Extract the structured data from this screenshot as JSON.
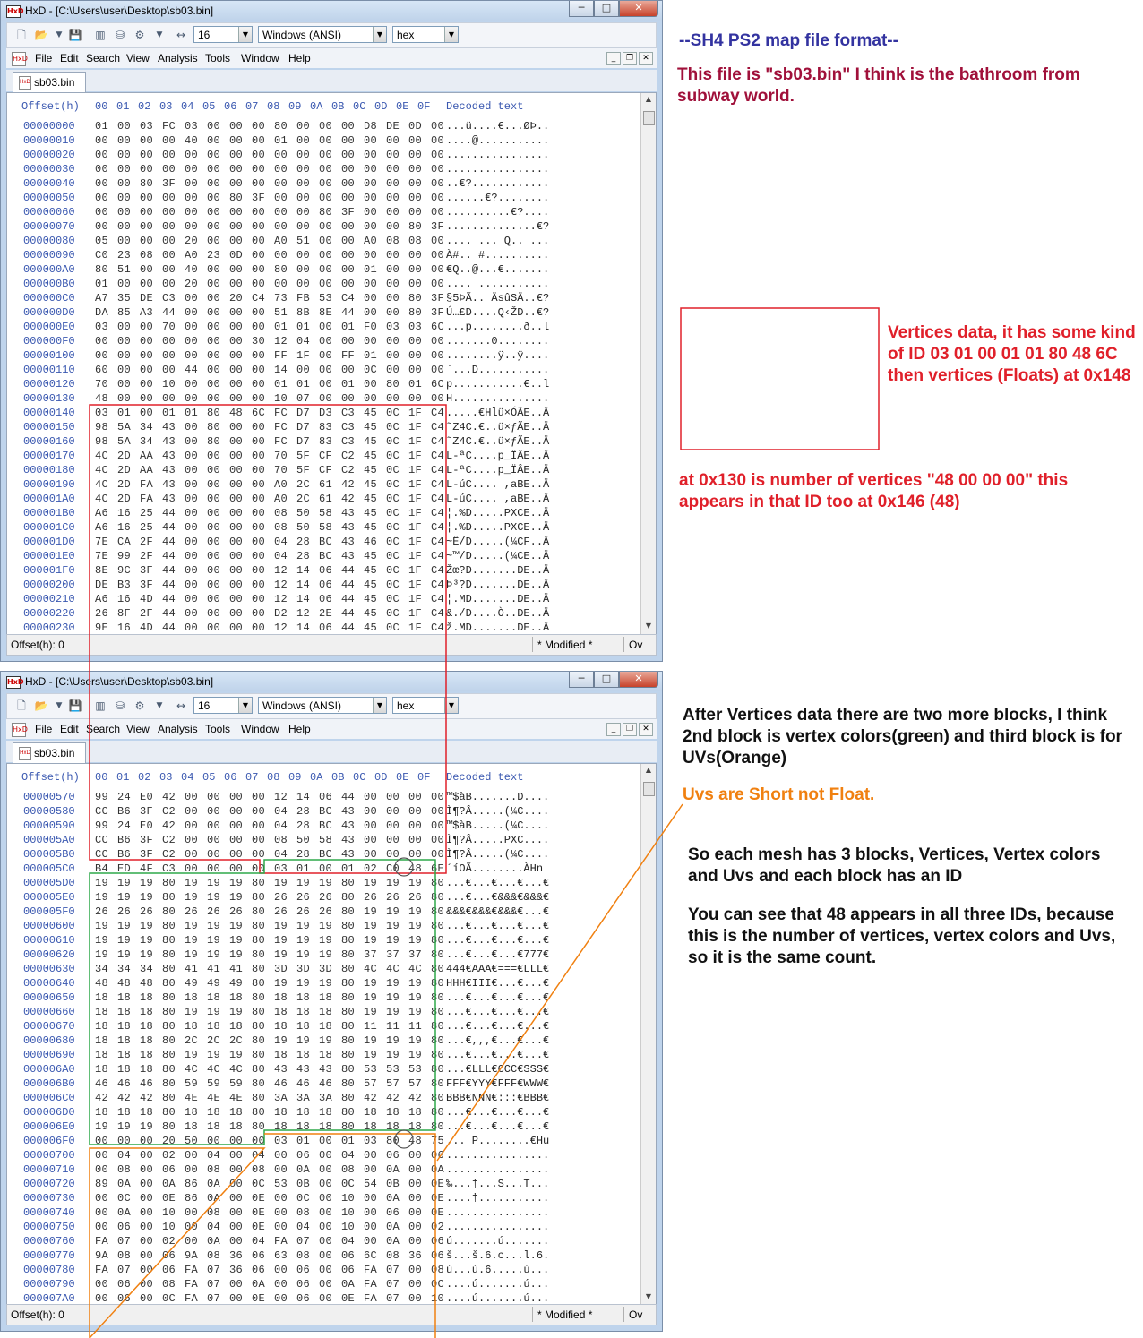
{
  "app": {
    "title": "HxD - [C:\\Users\\user\\Desktop\\sb03.bin]",
    "icon_text": "HxD",
    "window_buttons": [
      "─",
      "□",
      "✕"
    ],
    "toolbar": {
      "bytes_per_row": "16",
      "charset": "Windows (ANSI)",
      "offset_base": "hex"
    },
    "menu": [
      "File",
      "Edit",
      "Search",
      "View",
      "Analysis",
      "Tools",
      "Window",
      "Help"
    ],
    "tab": "sb03.bin",
    "header": {
      "offset": "Offset(h)",
      "columns": [
        "00",
        "01",
        "02",
        "03",
        "04",
        "05",
        "06",
        "07",
        "08",
        "09",
        "0A",
        "0B",
        "0C",
        "0D",
        "0E",
        "0F"
      ],
      "decoded": "Decoded text"
    },
    "status": {
      "offset": "Offset(h): 0",
      "modified": "* Modified *",
      "mode": "Ov"
    }
  },
  "window1_rows": [
    {
      "o": "00000000",
      "h": "01 00 03 FC 03 00 00 00 80 00 00 00 D8 DE 0D 00",
      "t": "...ü....€...ØÞ.."
    },
    {
      "o": "00000010",
      "h": "00 00 00 00 40 00 00 00 01 00 00 00 00 00 00 00",
      "t": "....@..........."
    },
    {
      "o": "00000020",
      "h": "00 00 00 00 00 00 00 00 00 00 00 00 00 00 00 00",
      "t": "................"
    },
    {
      "o": "00000030",
      "h": "00 00 00 00 00 00 00 00 00 00 00 00 00 00 00 00",
      "t": "................"
    },
    {
      "o": "00000040",
      "h": "00 00 80 3F 00 00 00 00 00 00 00 00 00 00 00 00",
      "t": "..€?............"
    },
    {
      "o": "00000050",
      "h": "00 00 00 00 00 00 80 3F 00 00 00 00 00 00 00 00",
      "t": "......€?........"
    },
    {
      "o": "00000060",
      "h": "00 00 00 00 00 00 00 00 00 00 80 3F 00 00 00 00",
      "t": "..........€?...."
    },
    {
      "o": "00000070",
      "h": "00 00 00 00 00 00 00 00 00 00 00 00 00 00 80 3F",
      "t": "..............€?"
    },
    {
      "o": "00000080",
      "h": "05 00 00 00 20 00 00 00 A0 51 00 00 A0 08 08 00",
      "t": ".... ... Q.. ..."
    },
    {
      "o": "00000090",
      "h": "C0 23 08 00 A0 23 0D 00 00 00 00 00 00 00 00 00",
      "t": "À#.. #.........."
    },
    {
      "o": "000000A0",
      "h": "80 51 00 00 40 00 00 00 80 00 00 00 01 00 00 00",
      "t": "€Q..@...€......."
    },
    {
      "o": "000000B0",
      "h": "01 00 00 00 20 00 00 00 00 00 00 00 00 00 00 00",
      "t": ".... ..........."
    },
    {
      "o": "000000C0",
      "h": "A7 35 DE C3 00 00 20 C4 73 FB 53 C4 00 00 80 3F",
      "t": "§5ÞÃ.. ÄsûSÄ..€?"
    },
    {
      "o": "000000D0",
      "h": "DA 85 A3 44 00 00 00 00 51 8B 8E 44 00 00 80 3F",
      "t": "Ú…£D....Q‹ŽD..€?"
    },
    {
      "o": "000000E0",
      "h": "03 00 00 70 00 00 00 00 01 01 00 01 F0 03 03 6C",
      "t": "...p........ð..l"
    },
    {
      "o": "000000F0",
      "h": "00 00 00 00 00 00 00 30 12 04 00 00 00 00 00 00",
      "t": ".......0........"
    },
    {
      "o": "00000100",
      "h": "00 00 00 00 00 00 00 00 FF 1F 00 FF 01 00 00 00",
      "t": "........ÿ..ÿ...."
    },
    {
      "o": "00000110",
      "h": "60 00 00 00 44 00 00 00 14 00 00 00 0C 00 00 00",
      "t": "`...D..........."
    },
    {
      "o": "00000120",
      "h": "70 00 00 10 00 00 00 00 01 01 00 01 00 80 01 6C",
      "t": "p...........€..l"
    },
    {
      "o": "00000130",
      "h": "48 00 00 00 00 00 00 00 10 07 00 00 00 00 00 00",
      "t": "H..............."
    },
    {
      "o": "00000140",
      "h": "03 01 00 01 01 80 48 6C FC D7 D3 C3 45 0C 1F C4",
      "t": ".....€Hlü×ÓÃE..Ä"
    },
    {
      "o": "00000150",
      "h": "98 5A 34 43 00 80 00 00 FC D7 83 C3 45 0C 1F C4",
      "t": "˜Z4C.€..ü×ƒÃE..Ä"
    },
    {
      "o": "00000160",
      "h": "98 5A 34 43 00 80 00 00 FC D7 83 C3 45 0C 1F C4",
      "t": "˜Z4C.€..ü×ƒÃE..Ä"
    },
    {
      "o": "00000170",
      "h": "4C 2D AA 43 00 00 00 00 70 5F CF C2 45 0C 1F C4",
      "t": "L-ªC....p_ÏÂE..Ä"
    },
    {
      "o": "00000180",
      "h": "4C 2D AA 43 00 00 00 00 70 5F CF C2 45 0C 1F C4",
      "t": "L-ªC....p_ÏÂE..Ä"
    },
    {
      "o": "00000190",
      "h": "4C 2D FA 43 00 00 00 00 A0 2C 61 42 45 0C 1F C4",
      "t": "L-úC.... ,aBE..Ä"
    },
    {
      "o": "000001A0",
      "h": "4C 2D FA 43 00 00 00 00 A0 2C 61 42 45 0C 1F C4",
      "t": "L-úC.... ,aBE..Ä"
    },
    {
      "o": "000001B0",
      "h": "A6 16 25 44 00 00 00 00 08 50 58 43 45 0C 1F C4",
      "t": "¦.%D.....PXCE..Ä"
    },
    {
      "o": "000001C0",
      "h": "A6 16 25 44 00 00 00 00 08 50 58 43 45 0C 1F C4",
      "t": "¦.%D.....PXCE..Ä"
    },
    {
      "o": "000001D0",
      "h": "7E CA 2F 44 00 00 00 00 04 28 BC 43 46 0C 1F C4",
      "t": "~Ê/D.....(¼CF..Ä"
    },
    {
      "o": "000001E0",
      "h": "7E 99 2F 44 00 00 00 00 04 28 BC 43 45 0C 1F C4",
      "t": "~™/D.....(¼CE..Ä"
    },
    {
      "o": "000001F0",
      "h": "8E 9C 3F 44 00 00 00 00 12 14 06 44 45 0C 1F C4",
      "t": "Žœ?D.......DE..Ä"
    },
    {
      "o": "00000200",
      "h": "DE B3 3F 44 00 00 00 00 12 14 06 44 45 0C 1F C4",
      "t": "Þ³?D.......DE..Ä"
    },
    {
      "o": "00000210",
      "h": "A6 16 4D 44 00 00 00 00 12 14 06 44 45 0C 1F C4",
      "t": "¦.MD.......DE..Ä"
    },
    {
      "o": "00000220",
      "h": "26 8F 2F 44 00 00 00 00 D2 12 2E 44 45 0C 1F C4",
      "t": "&./D....Ò..DE..Ä"
    },
    {
      "o": "00000230",
      "h": "9E 16 4D 44 00 00 00 00 12 14 06 44 45 0C 1F C4",
      "t": "ž.MD.......DE..Ä"
    }
  ],
  "window2_rows": [
    {
      "o": "00000570",
      "h": "99 24 E0 42 00 00 00 00 12 14 06 44 00 00 00 00",
      "t": "™$àB.......D...."
    },
    {
      "o": "00000580",
      "h": "CC B6 3F C2 00 00 00 00 04 28 BC 43 00 00 00 00",
      "t": "Ì¶?Â.....(¼C...."
    },
    {
      "o": "00000590",
      "h": "99 24 E0 42 00 00 00 00 04 28 BC 43 00 00 00 00",
      "t": "™$àB.....(¼C...."
    },
    {
      "o": "000005A0",
      "h": "CC B6 3F C2 00 00 00 00 08 50 58 43 00 00 00 00",
      "t": "Ì¶?Â.....PXC...."
    },
    {
      "o": "000005B0",
      "h": "CC B6 3F C2 00 00 00 00 04 28 BC 43 00 00 00 00",
      "t": "Ì¶?Â.....(¼C...."
    },
    {
      "o": "000005C0",
      "h": "B4 ED 4F C3 00 00 00 00 03 01 00 01 02 C0 48 6E",
      "t": "´íOÃ........ÀHn"
    },
    {
      "o": "000005D0",
      "h": "19 19 19 80 19 19 19 80 19 19 19 80 19 19 19 80",
      "t": "...€...€...€...€"
    },
    {
      "o": "000005E0",
      "h": "19 19 19 80 19 19 19 80 26 26 26 80 26 26 26 80",
      "t": "...€...€&&&€&&&€"
    },
    {
      "o": "000005F0",
      "h": "26 26 26 80 26 26 26 80 26 26 26 80 19 19 19 80",
      "t": "&&&€&&&€&&&€...€"
    },
    {
      "o": "00000600",
      "h": "19 19 19 80 19 19 19 80 19 19 19 80 19 19 19 80",
      "t": "...€...€...€...€"
    },
    {
      "o": "00000610",
      "h": "19 19 19 80 19 19 19 80 19 19 19 80 19 19 19 80",
      "t": "...€...€...€...€"
    },
    {
      "o": "00000620",
      "h": "19 19 19 80 19 19 19 80 19 19 19 80 37 37 37 80",
      "t": "...€...€...€777€"
    },
    {
      "o": "00000630",
      "h": "34 34 34 80 41 41 41 80 3D 3D 3D 80 4C 4C 4C 80",
      "t": "444€AAA€===€LLL€"
    },
    {
      "o": "00000640",
      "h": "48 48 48 80 49 49 49 80 19 19 19 80 19 19 19 80",
      "t": "HHH€III€...€...€"
    },
    {
      "o": "00000650",
      "h": "18 18 18 80 18 18 18 80 18 18 18 80 19 19 19 80",
      "t": "...€...€...€...€"
    },
    {
      "o": "00000660",
      "h": "18 18 18 80 19 19 19 80 18 18 18 80 19 19 19 80",
      "t": "...€...€...€...€"
    },
    {
      "o": "00000670",
      "h": "18 18 18 80 18 18 18 80 18 18 18 80 11 11 11 80",
      "t": "...€...€...€...€"
    },
    {
      "o": "00000680",
      "h": "18 18 18 80 2C 2C 2C 80 19 19 19 80 19 19 19 80",
      "t": "...€,,,€...€...€"
    },
    {
      "o": "00000690",
      "h": "18 18 18 80 19 19 19 80 18 18 18 80 19 19 19 80",
      "t": "...€...€...€...€"
    },
    {
      "o": "000006A0",
      "h": "18 18 18 80 4C 4C 4C 80 43 43 43 80 53 53 53 80",
      "t": "...€LLL€CCC€SSS€"
    },
    {
      "o": "000006B0",
      "h": "46 46 46 80 59 59 59 80 46 46 46 80 57 57 57 80",
      "t": "FFF€YYY€FFF€WWW€"
    },
    {
      "o": "000006C0",
      "h": "42 42 42 80 4E 4E 4E 80 3A 3A 3A 80 42 42 42 80",
      "t": "BBB€NNN€:::€BBB€"
    },
    {
      "o": "000006D0",
      "h": "18 18 18 80 18 18 18 80 18 18 18 80 18 18 18 80",
      "t": "...€...€...€...€"
    },
    {
      "o": "000006E0",
      "h": "19 19 19 80 18 18 18 80 18 18 18 80 18 18 18 80",
      "t": "...€...€...€...€"
    },
    {
      "o": "000006F0",
      "h": "00 00 00 20 50 00 00 00 03 01 00 01 03 80 48 75",
      "t": "... P........€Hu"
    },
    {
      "o": "00000700",
      "h": "00 04 00 02 00 04 00 04 00 06 00 04 00 06 00 06",
      "t": "................"
    },
    {
      "o": "00000710",
      "h": "00 08 00 06 00 08 00 08 00 0A 00 08 00 0A 00 0A",
      "t": "................"
    },
    {
      "o": "00000720",
      "h": "89 0A 00 0A 86 0A 00 0C 53 0B 00 0C 54 0B 00 0E",
      "t": "‰...†...S...T..."
    },
    {
      "o": "00000730",
      "h": "00 0C 00 0E 86 0A 00 0E 00 0C 00 10 00 0A 00 0E",
      "t": "....†..........."
    },
    {
      "o": "00000740",
      "h": "00 0A 00 10 00 08 00 0E 00 08 00 10 00 06 00 0E",
      "t": "................"
    },
    {
      "o": "00000750",
      "h": "00 06 00 10 00 04 00 0E 00 04 00 10 00 0A 00 02",
      "t": "................"
    },
    {
      "o": "00000760",
      "h": "FA 07 00 02 00 0A 00 04 FA 07 00 04 00 0A 00 06",
      "t": "ú.......ú......."
    },
    {
      "o": "00000770",
      "h": "9A 08 00 06 9A 08 36 06 63 08 00 06 6C 08 36 06",
      "t": "š...š.6.c...l.6."
    },
    {
      "o": "00000780",
      "h": "FA 07 00 06 FA 07 36 06 00 06 00 06 FA 07 00 08",
      "t": "ú...ú.6.....ú..."
    },
    {
      "o": "00000790",
      "h": "00 06 00 08 FA 07 00 0A 00 06 00 0A FA 07 00 0C",
      "t": "....ú.......ú..."
    },
    {
      "o": "000007A0",
      "h": "00 06 00 0C FA 07 00 0E 00 06 00 0E FA 07 00 10",
      "t": "....ú.......ú..."
    }
  ],
  "annotations": {
    "title": "--SH4 PS2 map file format--",
    "intro": "This file is \"sb03.bin\" I think is the bathroom from subway world.",
    "vertices": "Vertices data, it has some kind of ID 03 01 00 01 01 80 48 6C then vertices (Floats)  at 0x148",
    "count": "at 0x130 is number of vertices \"48 00 00 00\" this appears in that ID too at 0x146 (48)",
    "blocks": "After Vertices data there are two more blocks, I think 2nd block is vertex colors(green) and third block is for UVs(Orange)",
    "uvs": "Uvs are Short not Float.",
    "mesh": "So each mesh has 3 blocks, Vertices, Vertex colors and Uvs and each block has an ID",
    "same_count": "You can see that 48 appears in all three IDs, because this is the number of vertices, vertex colors and Uvs, so it is the same count."
  },
  "colors": {
    "title_blue": "#3333a0",
    "intro_crimson": "#a0103a",
    "red": "#e0202a",
    "green": "#2ea84a",
    "orange": "#f08010",
    "hex_blue": "#3a58b0"
  }
}
